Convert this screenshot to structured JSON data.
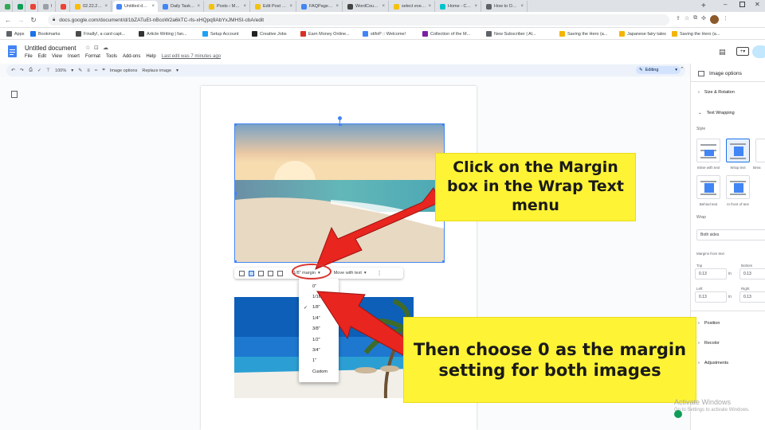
{
  "browser": {
    "tabs": [
      {
        "label": "",
        "icon": "chrome-icon",
        "color": "#34a853"
      },
      {
        "label": "",
        "icon": "sheets-icon",
        "color": "#0f9d58"
      },
      {
        "label": "",
        "icon": "gmail-icon",
        "color": "#ea4335"
      },
      {
        "label": "H|",
        "icon": "page-icon",
        "color": "#9aa0a6"
      },
      {
        "label": "M",
        "icon": "gmail-icon",
        "color": "#ea4335"
      },
      {
        "label": "02.22.22 - Goo",
        "icon": "drive-icon",
        "color": "#fbbc04"
      },
      {
        "label": "Untitled docu",
        "icon": "docs-icon",
        "color": "#4285f4",
        "active": true
      },
      {
        "label": "Daily Task Sum",
        "icon": "docs-icon",
        "color": "#4285f4"
      },
      {
        "label": "Posts ‹ Masche",
        "icon": "mt-icon",
        "color": "#f4c20d"
      },
      {
        "label": "Edit Post \"How",
        "icon": "mt-icon",
        "color": "#f4c20d"
      },
      {
        "label": "FAQPage JSON",
        "icon": "code-icon",
        "color": "#4285f4"
      },
      {
        "label": "WordCounter",
        "icon": "wc-icon",
        "color": "#444444"
      },
      {
        "label": "select everyth",
        "icon": "mt-icon",
        "color": "#f4c20d"
      },
      {
        "label": "Home - Canva",
        "icon": "canva-icon",
        "color": "#00c4cc"
      },
      {
        "label": "How to Overla",
        "icon": "globe-icon",
        "color": "#5f6368"
      }
    ],
    "url": "docs.google.com/document/d/1bZATuEt-nBcoW2a6kTC-rls-xHQpq9AbYxJMHSI-cbA/edit",
    "bookmarks": [
      {
        "label": "Apps",
        "color": "#5f6368"
      },
      {
        "label": "Bookmarks",
        "color": "#1a73e8"
      },
      {
        "label": "Finally!, a card capt...",
        "color": "#4a4a4a"
      },
      {
        "label": "Article Writing | fan...",
        "color": "#333333"
      },
      {
        "label": "Setup Account",
        "color": "#1da1f2"
      },
      {
        "label": "Creative Jobs",
        "color": "#222222"
      },
      {
        "label": "Earn Money Online...",
        "color": "#d93025"
      },
      {
        "label": "stifoP :: Welcome!",
        "color": "#4285f4"
      },
      {
        "label": "Collection of the M...",
        "color": "#7b1fa2"
      },
      {
        "label": "New Subscriber | Al...",
        "color": "#5f6368"
      },
      {
        "label": "Saving the Hero (a...",
        "color": "#f4b400"
      },
      {
        "label": "Japanese fairy tales",
        "color": "#f4b400"
      },
      {
        "label": "Saving the Hero (a...",
        "color": "#f4b400"
      }
    ]
  },
  "doc": {
    "title": "Untitled document",
    "menus": [
      "File",
      "Edit",
      "View",
      "Insert",
      "Format",
      "Tools",
      "Add-ons",
      "Help"
    ],
    "last_edit": "Last edit was 7 minutes ago",
    "toolbar": {
      "zoom": "100%",
      "image_options": "Image options",
      "replace_image": "Replace image",
      "editing": "Editing"
    }
  },
  "image_toolbar": {
    "margin_label": "1/8\" margin",
    "move_label": "Move with text"
  },
  "margin_dropdown": {
    "options": [
      "0\"",
      "1/16\"",
      "1/8\"",
      "1/4\"",
      "3/8\"",
      "1/2\"",
      "3/4\"",
      "1\"",
      "Custom"
    ],
    "selected_index": 2
  },
  "side_panel": {
    "title": "Image options",
    "size_rotation": "Size & Rotation",
    "text_wrapping": "Text Wrapping",
    "style_label": "Style",
    "wrap_styles": [
      "Inline with text",
      "Wrap text",
      "Brea",
      "Behind text",
      "In front of text"
    ],
    "wrap_label": "Wrap",
    "wrap_value": "Both sides",
    "margins_label": "Margins from text",
    "top_label": "Top",
    "top_value": "0.13",
    "bottom_label": "Bottom",
    "bottom_value": "0.13",
    "left_label": "Left",
    "left_value": "0.13",
    "right_label": "Right",
    "right_value": "0.13",
    "unit": "in",
    "position": "Position",
    "recolor": "Recolor",
    "adjustments": "Adjustments"
  },
  "annotations": {
    "callout_top": "Click on the Margin box in the Wrap Text menu",
    "callout_bottom": "Then choose 0 as the margin setting for both images",
    "arrow_color": "#e8251f",
    "callout_color": "#fef335"
  },
  "watermark": {
    "line1": "Activate Windows",
    "line2": "Go to Settings to activate Windows."
  }
}
